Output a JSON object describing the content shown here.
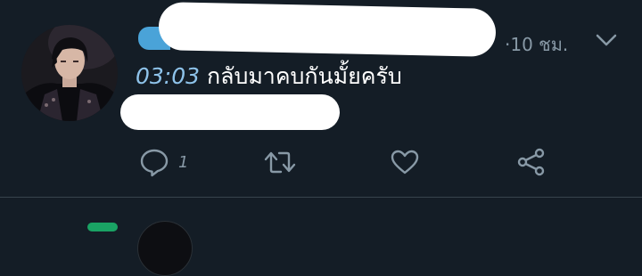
{
  "tweet": {
    "time_ago": "·10 ชม.",
    "timestamp_text": "03:03",
    "body_text": " กลับมาคบกันมั้ยครับ",
    "reply_count": "1"
  },
  "icons": {
    "caret": "chevron-down-icon",
    "reply": "reply-icon",
    "retweet": "retweet-icon",
    "like": "heart-icon",
    "share": "share-icon"
  },
  "colors": {
    "background": "#141d26",
    "muted": "#8899a6",
    "link": "#8ec3ea"
  }
}
